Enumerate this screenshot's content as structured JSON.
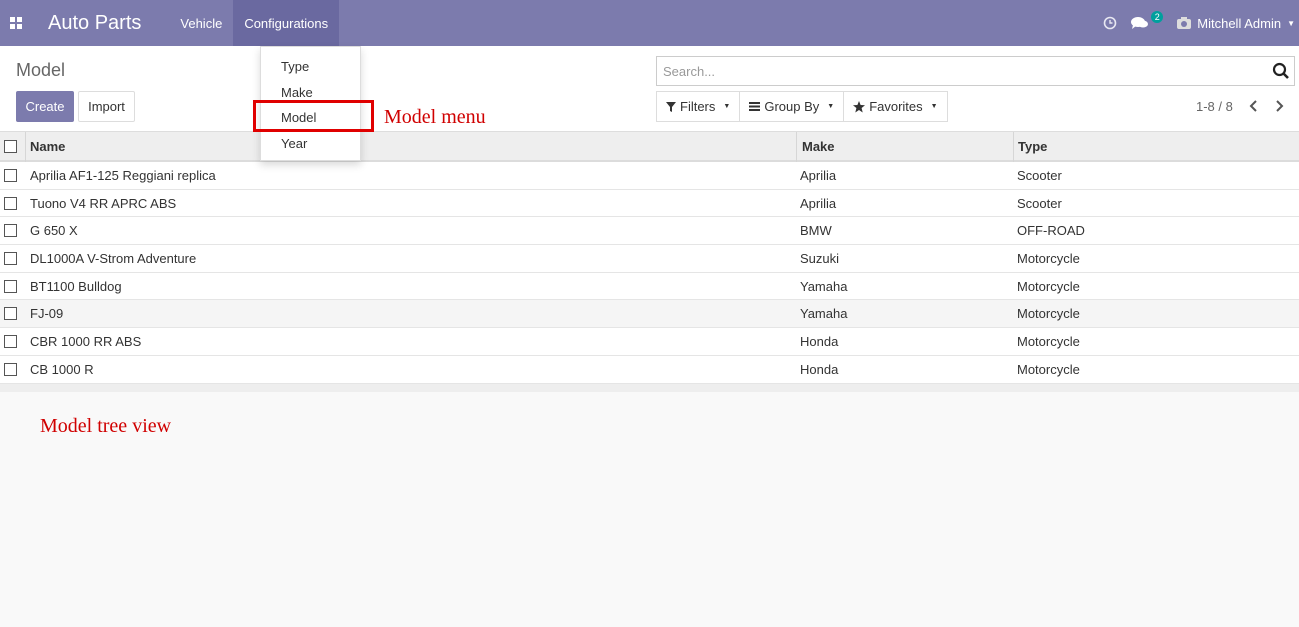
{
  "navbar": {
    "app_title": "Auto Parts",
    "menu": [
      "Vehicle",
      "Configurations"
    ],
    "active_menu": "Configurations",
    "notification_count": "2",
    "user_name": "Mitchell Admin",
    "bg_color": "#7c7bad"
  },
  "control_panel": {
    "breadcrumb": "Model",
    "create_label": "Create",
    "import_label": "Import",
    "search_placeholder": "Search...",
    "filters_label": "Filters",
    "group_by_label": "Group By",
    "favorites_label": "Favorites",
    "pager": "1-8 / 8"
  },
  "dropdown": {
    "items": [
      "Type",
      "Make",
      "Model",
      "Year"
    ]
  },
  "table": {
    "columns": [
      "Name",
      "Make",
      "Type"
    ],
    "rows": [
      {
        "name": "Aprilia AF1-125 Reggiani replica",
        "make": "Aprilia",
        "type": "Scooter"
      },
      {
        "name": "Tuono V4 RR APRC ABS",
        "make": "Aprilia",
        "type": "Scooter"
      },
      {
        "name": "G 650 X",
        "make": "BMW",
        "type": "OFF-ROAD"
      },
      {
        "name": "DL1000A V-Strom Adventure",
        "make": "Suzuki",
        "type": "Motorcycle"
      },
      {
        "name": "BT1100 Bulldog",
        "make": "Yamaha",
        "type": "Motorcycle"
      },
      {
        "name": "FJ-09",
        "make": "Yamaha",
        "type": "Motorcycle"
      },
      {
        "name": "CBR 1000 RR ABS",
        "make": "Honda",
        "type": "Motorcycle"
      },
      {
        "name": "CB 1000 R",
        "make": "Honda",
        "type": "Motorcycle"
      }
    ]
  },
  "annotations": {
    "menu_note": "Model menu",
    "view_note": "Model tree view",
    "color": "#d00000"
  }
}
